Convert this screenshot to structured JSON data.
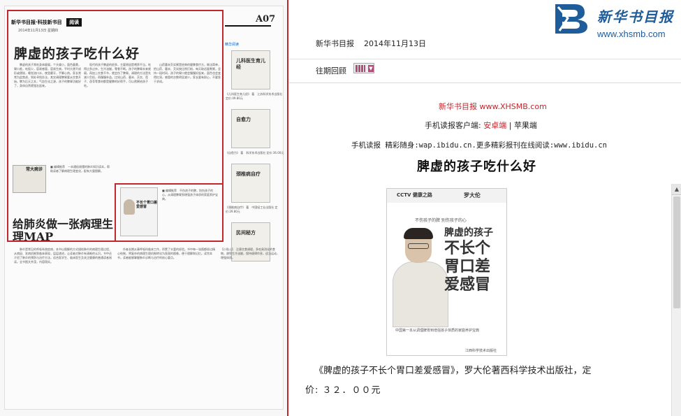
{
  "newspaper": {
    "masthead": "新华书目报·科技新书目",
    "section": "阅读",
    "date_line": "2014年11月13日  星期四",
    "page_number": "A07",
    "headline": "脾虚的孩子吃什么好",
    "second_headline": "给肺炎做一张病理生理MAP",
    "side_tag": "精华阅读",
    "side_books": [
      "儿科医生育儿经",
      "自愈力",
      "颈椎病自疗",
      "民间秘方"
    ],
    "inset_book_title": "常大病诊",
    "mini_cover_title": "不长个胃口差爱感冒"
  },
  "logo": {
    "script": "新华书目报",
    "url": "www.xhsmb.com"
  },
  "header": {
    "publication": "新华书目报",
    "date": "2014年11月13日"
  },
  "nav": {
    "back_issues": "往期回顾",
    "calendar_arrow": "▼"
  },
  "source": {
    "prefix": "新华书目报 ",
    "url": "www.XHSMB.com"
  },
  "client": {
    "label": "手机读报客户端:",
    "android": "安卓端",
    "sep": "|",
    "apple": "苹果端"
  },
  "reader": {
    "text": "手机读报 精彩随身:wap.ibidu.cn.更多精彩报刊在线阅读:www.ibidu.cn"
  },
  "article": {
    "title": "脾虚的孩子吃什么好"
  },
  "cover": {
    "cctv": "CCTV 健康之路",
    "author": "罗大伦",
    "tagline": "不伤孩子的脾  别伤孩子的心",
    "title_line_1": "脾虚的孩子",
    "title_line_2": "不长个",
    "title_line_3": "胃口差",
    "title_line_4": "爱感冒",
    "bottom_text": "中国第一本从调理脾胃到增强孩子体质的家庭养护宝典",
    "publisher": "江西科学技术出版社"
  },
  "caption": {
    "text": "《脾虚的孩子不长个胃口差爱感冒》，罗大伦著西科学技术出版社，定"
  },
  "price": {
    "text": "价:  ３２．００元"
  }
}
